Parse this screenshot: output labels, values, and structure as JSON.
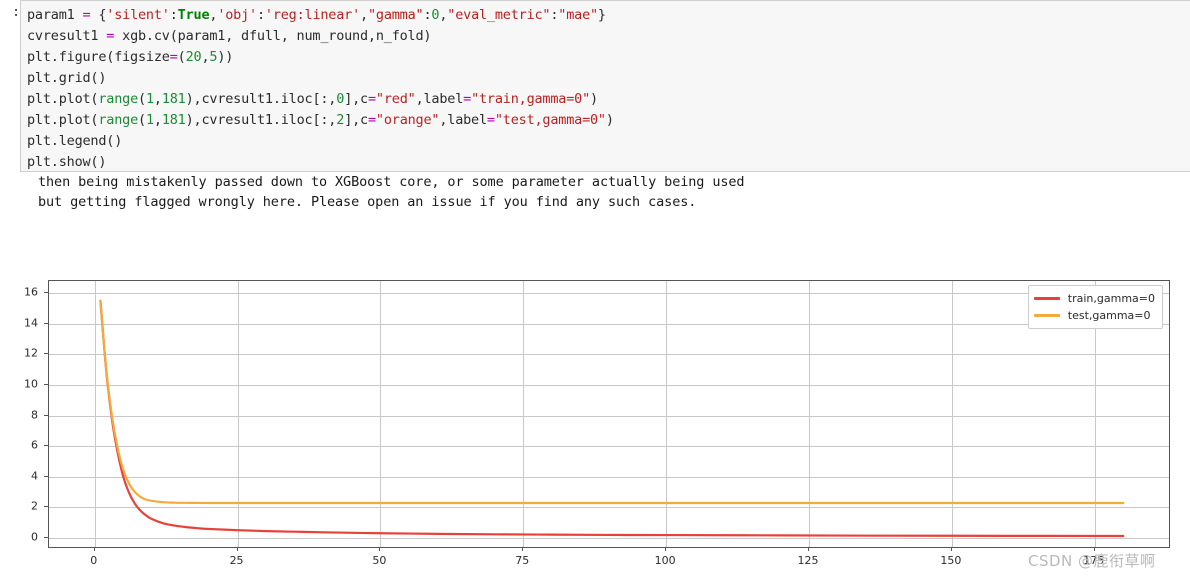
{
  "notebook": {
    "prompt": ":",
    "code_lines": [
      [
        {
          "t": "param1 ",
          "c": "plain"
        },
        {
          "t": "=",
          "c": "op"
        },
        {
          "t": " {",
          "c": "plain"
        },
        {
          "t": "'silent'",
          "c": "str"
        },
        {
          "t": ":",
          "c": "plain"
        },
        {
          "t": "True",
          "c": "kw"
        },
        {
          "t": ",",
          "c": "plain"
        },
        {
          "t": "'obj'",
          "c": "str"
        },
        {
          "t": ":",
          "c": "plain"
        },
        {
          "t": "'reg:linear'",
          "c": "str"
        },
        {
          "t": ",",
          "c": "plain"
        },
        {
          "t": "\"gamma\"",
          "c": "str"
        },
        {
          "t": ":",
          "c": "plain"
        },
        {
          "t": "0",
          "c": "num"
        },
        {
          "t": ",",
          "c": "plain"
        },
        {
          "t": "\"eval_metric\"",
          "c": "str"
        },
        {
          "t": ":",
          "c": "plain"
        },
        {
          "t": "\"mae\"",
          "c": "str"
        },
        {
          "t": "}",
          "c": "plain"
        }
      ],
      [
        {
          "t": "cvresult1 ",
          "c": "plain"
        },
        {
          "t": "=",
          "c": "op"
        },
        {
          "t": " xgb.cv(param1, dfull, num_round,n_fold)",
          "c": "plain"
        }
      ],
      [
        {
          "t": "plt.figure(figsize",
          "c": "plain"
        },
        {
          "t": "=",
          "c": "op"
        },
        {
          "t": "(",
          "c": "plain"
        },
        {
          "t": "20",
          "c": "num"
        },
        {
          "t": ",",
          "c": "plain"
        },
        {
          "t": "5",
          "c": "num"
        },
        {
          "t": "))",
          "c": "plain"
        }
      ],
      [
        {
          "t": "plt.grid()",
          "c": "plain"
        }
      ],
      [
        {
          "t": "plt.plot(",
          "c": "plain"
        },
        {
          "t": "range",
          "c": "builtin"
        },
        {
          "t": "(",
          "c": "plain"
        },
        {
          "t": "1",
          "c": "num"
        },
        {
          "t": ",",
          "c": "plain"
        },
        {
          "t": "181",
          "c": "num"
        },
        {
          "t": "),cvresult1.iloc[:,",
          "c": "plain"
        },
        {
          "t": "0",
          "c": "num"
        },
        {
          "t": "],c",
          "c": "plain"
        },
        {
          "t": "=",
          "c": "op"
        },
        {
          "t": "\"red\"",
          "c": "str"
        },
        {
          "t": ",label",
          "c": "plain"
        },
        {
          "t": "=",
          "c": "op"
        },
        {
          "t": "\"train,gamma=0\"",
          "c": "str"
        },
        {
          "t": ")",
          "c": "plain"
        }
      ],
      [
        {
          "t": "plt.plot(",
          "c": "plain"
        },
        {
          "t": "range",
          "c": "builtin"
        },
        {
          "t": "(",
          "c": "plain"
        },
        {
          "t": "1",
          "c": "num"
        },
        {
          "t": ",",
          "c": "plain"
        },
        {
          "t": "181",
          "c": "num"
        },
        {
          "t": "),cvresult1.iloc[:,",
          "c": "plain"
        },
        {
          "t": "2",
          "c": "num"
        },
        {
          "t": "],c",
          "c": "plain"
        },
        {
          "t": "=",
          "c": "op"
        },
        {
          "t": "\"orange\"",
          "c": "str"
        },
        {
          "t": ",label",
          "c": "plain"
        },
        {
          "t": "=",
          "c": "op"
        },
        {
          "t": "\"test,gamma=0\"",
          "c": "str"
        },
        {
          "t": ")",
          "c": "plain"
        }
      ],
      [
        {
          "t": "plt.legend()",
          "c": "plain"
        }
      ],
      [
        {
          "t": "plt.show()",
          "c": "plain"
        }
      ]
    ],
    "warning_lines": [
      "then being mistakenly passed down to XGBoost core, or some parameter actually being used",
      "but getting flagged wrongly here. Please open an issue if you find any such cases."
    ]
  },
  "watermark": "CSDN @鹿衔草啊",
  "chart_data": {
    "type": "line",
    "title": "",
    "xlabel": "",
    "ylabel": "",
    "xlim": [
      -8,
      188
    ],
    "ylim": [
      -0.6,
      16.8
    ],
    "xticks": [
      0,
      25,
      50,
      75,
      100,
      125,
      150,
      175
    ],
    "yticks": [
      0,
      2,
      4,
      6,
      8,
      10,
      12,
      14,
      16
    ],
    "grid": true,
    "legend_position": "upper right",
    "series": [
      {
        "name": "train,gamma=0",
        "color": "#e8413a",
        "x": [
          1,
          2,
          3,
          4,
          5,
          6,
          7,
          8,
          9,
          10,
          12,
          14,
          16,
          18,
          20,
          25,
          30,
          35,
          40,
          50,
          60,
          70,
          80,
          90,
          100,
          120,
          140,
          160,
          180
        ],
        "y": [
          15.5,
          11.0,
          7.8,
          5.6,
          4.0,
          2.95,
          2.25,
          1.78,
          1.46,
          1.23,
          0.95,
          0.8,
          0.7,
          0.63,
          0.58,
          0.5,
          0.44,
          0.4,
          0.36,
          0.3,
          0.26,
          0.23,
          0.21,
          0.19,
          0.18,
          0.16,
          0.14,
          0.13,
          0.12
        ]
      },
      {
        "name": "test,gamma=0",
        "color": "#f5a93b",
        "x": [
          1,
          2,
          3,
          4,
          5,
          6,
          7,
          8,
          9,
          10,
          12,
          14,
          16,
          18,
          20,
          25,
          30,
          35,
          40,
          50,
          60,
          70,
          80,
          90,
          100,
          120,
          140,
          160,
          180
        ],
        "y": [
          15.5,
          11.1,
          8.0,
          5.9,
          4.45,
          3.55,
          3.0,
          2.68,
          2.5,
          2.42,
          2.33,
          2.3,
          2.29,
          2.285,
          2.28,
          2.28,
          2.28,
          2.28,
          2.28,
          2.28,
          2.28,
          2.28,
          2.28,
          2.28,
          2.28,
          2.28,
          2.28,
          2.28,
          2.28
        ]
      }
    ]
  }
}
